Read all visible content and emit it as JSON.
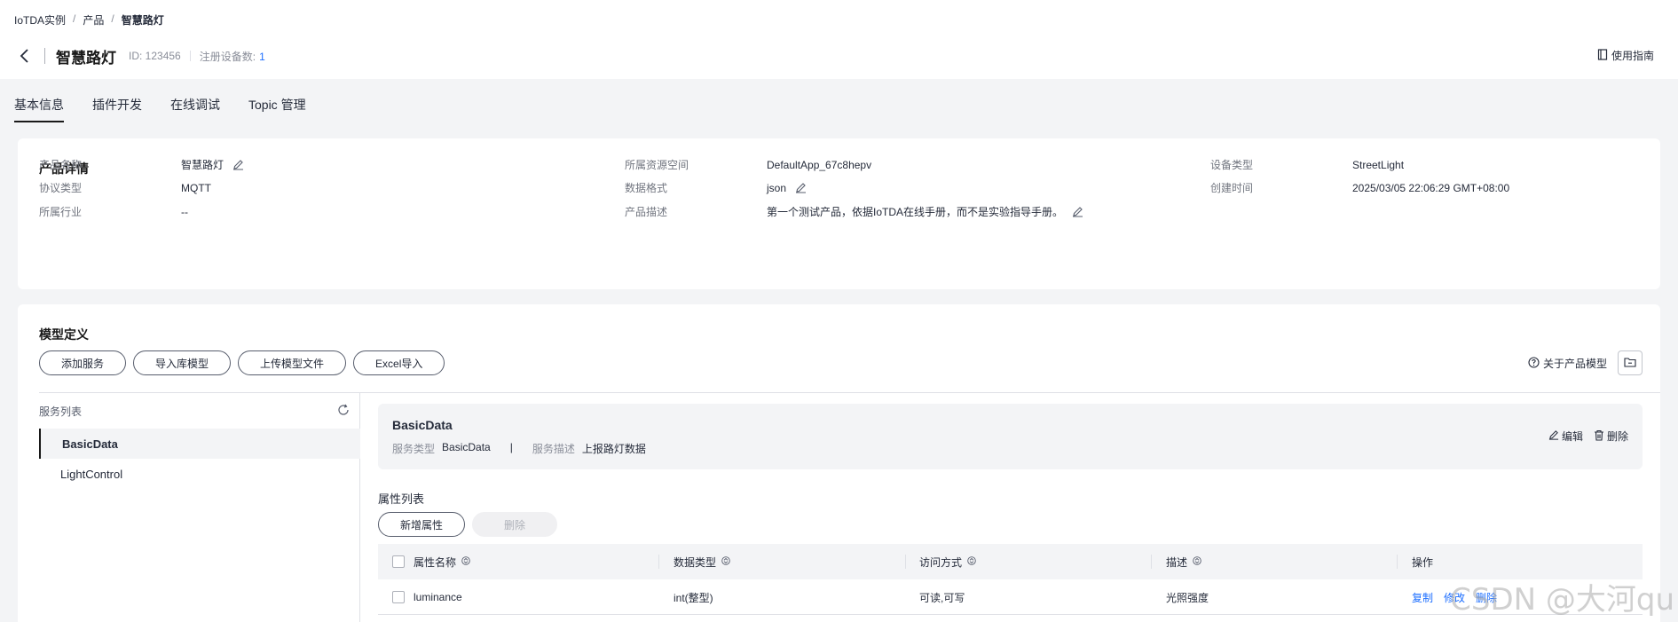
{
  "breadcrumb": [
    "IoTDA实例",
    "产品",
    "智慧路灯"
  ],
  "header": {
    "title": "智慧路灯",
    "id_text": "ID: 123456",
    "devices_label": "注册设备数:",
    "devices_count": "1",
    "guide_label": "使用指南"
  },
  "tabs": [
    {
      "label": "基本信息",
      "active": true
    },
    {
      "label": "插件开发",
      "active": false
    },
    {
      "label": "在线调试",
      "active": false
    },
    {
      "label": "Topic 管理",
      "active": false
    }
  ],
  "product_details": {
    "title": "产品详情",
    "fields": [
      {
        "label": "产品名称",
        "value": "智慧路灯",
        "editable": true
      },
      {
        "label": "协议类型",
        "value": "MQTT",
        "editable": false
      },
      {
        "label": "所属行业",
        "value": "--",
        "editable": false
      },
      {
        "label": "所属资源空间",
        "value": "DefaultApp_67c8hepv",
        "editable": false
      },
      {
        "label": "数据格式",
        "value": "json",
        "editable": true
      },
      {
        "label": "产品描述",
        "value": "第一个测试产品，依据IoTDA在线手册，而不是实验指导手册。",
        "editable": true
      },
      {
        "label": "设备类型",
        "value": "StreetLight",
        "editable": false
      },
      {
        "label": "创建时间",
        "value": "2025/03/05 22:06:29 GMT+08:00",
        "editable": false
      }
    ]
  },
  "model": {
    "title": "模型定义",
    "buttons": [
      "添加服务",
      "导入库模型",
      "上传模型文件",
      "Excel导入"
    ],
    "about_label": "关于产品模型",
    "service_list_label": "服务列表",
    "services": [
      {
        "name": "BasicData",
        "active": true
      },
      {
        "name": "LightControl",
        "active": false
      }
    ],
    "selected": {
      "name": "BasicData",
      "type_label": "服务类型",
      "type_value": "BasicData",
      "sep": "|",
      "desc_label": "服务描述",
      "desc_value": "上报路灯数据",
      "edit_label": "编辑",
      "delete_label": "删除"
    },
    "attr_title": "属性列表",
    "add_attr_label": "新增属性",
    "delete_attr_label": "删除",
    "columns": [
      "属性名称",
      "数据类型",
      "访问方式",
      "描述",
      "操作"
    ],
    "rows": [
      {
        "name": "luminance",
        "type": "int(整型)",
        "access": "可读,可写",
        "desc": "光照强度",
        "actions": [
          "复制",
          "修改",
          "删除"
        ]
      }
    ]
  },
  "watermark": "CSDN @大河qu",
  "colors": {
    "accent": "#1e6fff",
    "text": "#252b3a",
    "background": "#f3f4f6"
  }
}
